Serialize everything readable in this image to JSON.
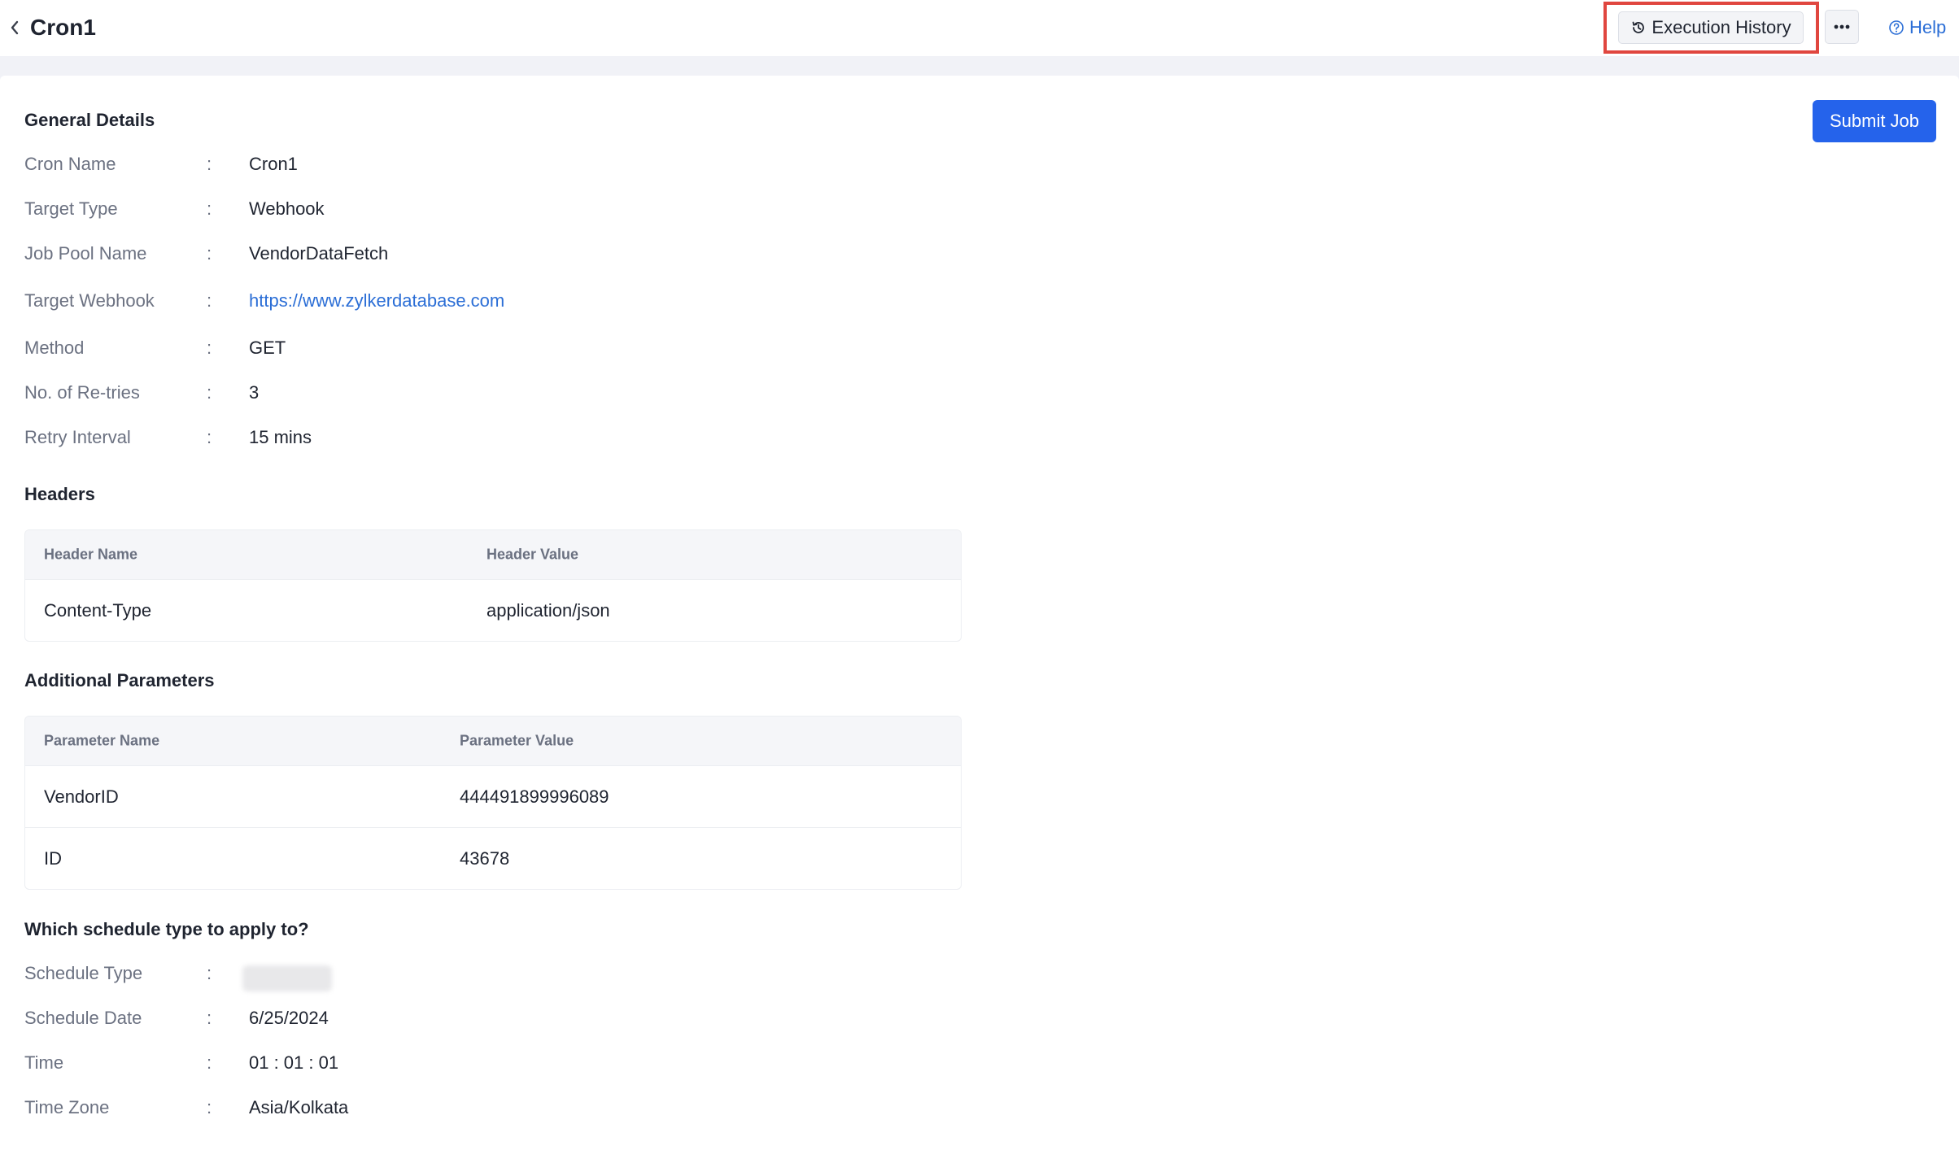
{
  "header": {
    "title": "Cron1",
    "execution_history_label": "Execution History",
    "help_label": "Help"
  },
  "submit_label": "Submit Job",
  "general": {
    "title": "General Details",
    "fields": [
      {
        "label": "Cron Name",
        "value": "Cron1"
      },
      {
        "label": "Target Type",
        "value": "Webhook"
      },
      {
        "label": "Job Pool Name",
        "value": "VendorDataFetch"
      },
      {
        "label": "Target Webhook",
        "value": "https://www.zylkerdatabase.com"
      },
      {
        "label": "Method",
        "value": "GET"
      },
      {
        "label": "No. of Re-tries",
        "value": "3"
      },
      {
        "label": "Retry Interval",
        "value": "15 mins"
      }
    ]
  },
  "headers": {
    "title": "Headers",
    "columns": [
      "Header Name",
      "Header Value"
    ],
    "rows": [
      [
        "Content-Type",
        "application/json"
      ]
    ]
  },
  "params": {
    "title": "Additional Parameters",
    "columns": [
      "Parameter Name",
      "Parameter Value"
    ],
    "rows": [
      [
        "VendorID",
        "444491899996089"
      ],
      [
        "ID",
        "43678"
      ]
    ]
  },
  "schedule": {
    "title": "Which schedule type to apply to?",
    "fields": [
      {
        "label": "Schedule Type",
        "value": ""
      },
      {
        "label": "Schedule Date",
        "value": "6/25/2024"
      },
      {
        "label": "Time",
        "value": "01 : 01 : 01"
      },
      {
        "label": "Time Zone",
        "value": "Asia/Kolkata"
      }
    ]
  },
  "colors": {
    "accent": "#2563eb",
    "link": "#2b6ed6",
    "highlight": "#e0463f"
  },
  "icons": {
    "back": "chevron-left-icon",
    "history": "history-icon",
    "more": "more-horizontal-icon",
    "help": "help-circle-icon"
  }
}
